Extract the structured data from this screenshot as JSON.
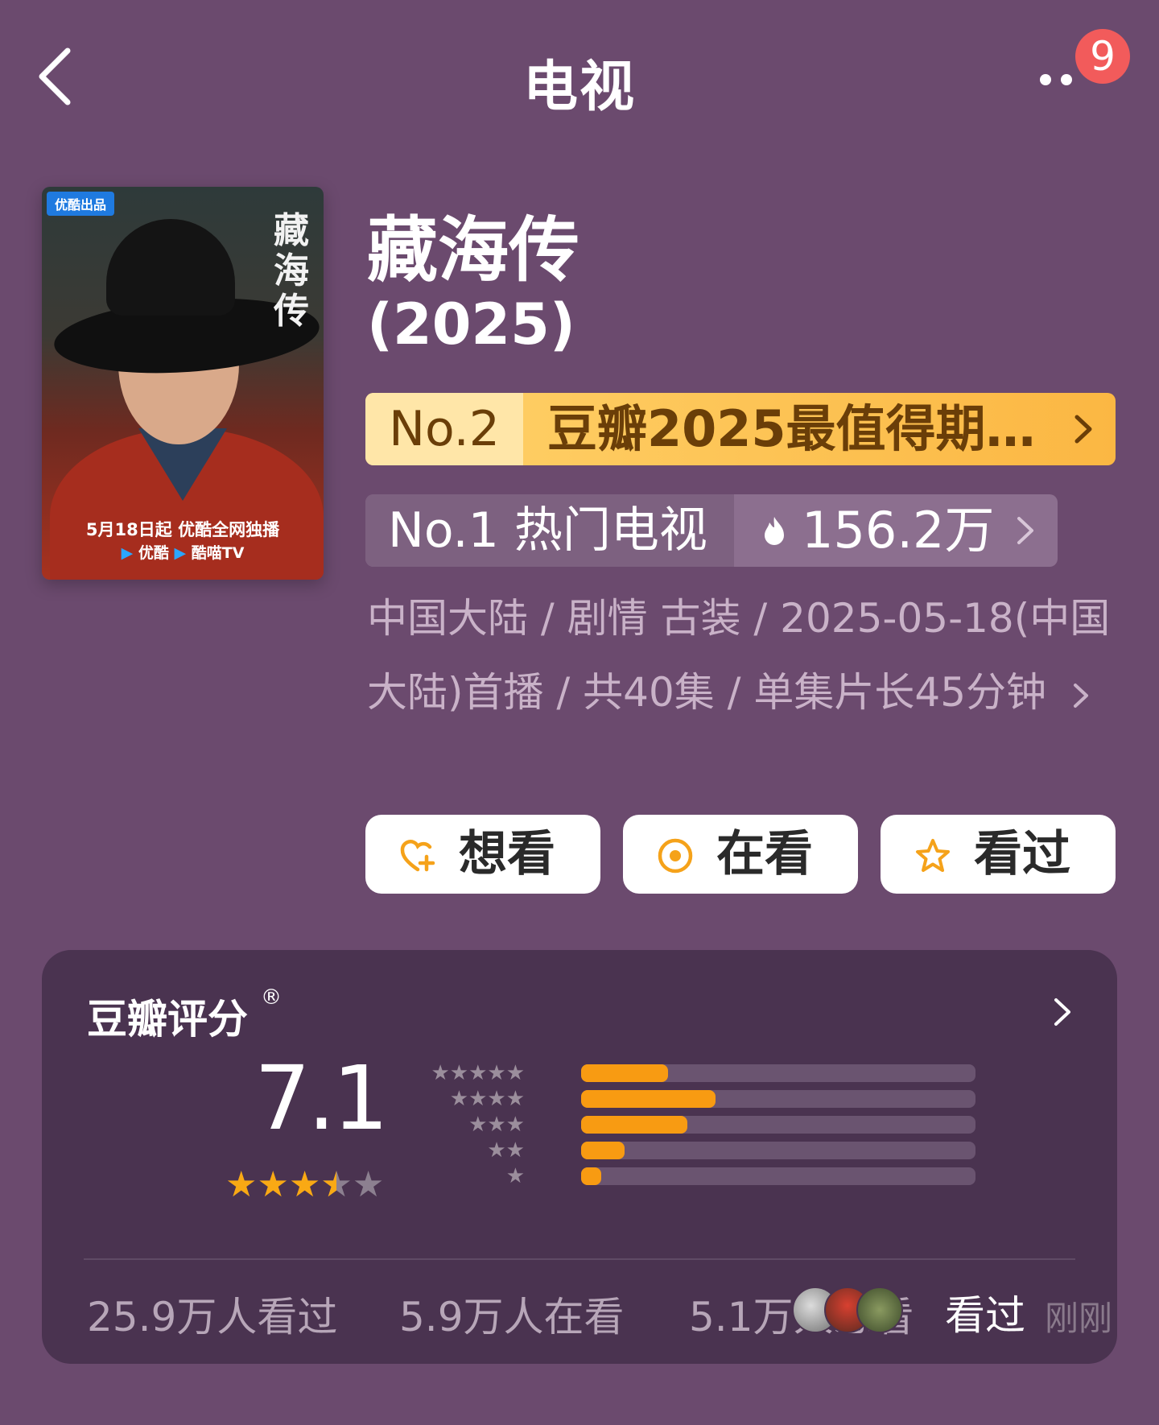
{
  "header": {
    "title": "电视",
    "notification_count": "9"
  },
  "poster": {
    "tag": "优酷出品",
    "calligraphy": "藏海传",
    "air_text": "5月18日起 优酷全网独播",
    "platform_1": "优酷",
    "platform_2": "酷喵TV"
  },
  "show": {
    "title": "藏海传",
    "year": "(2025)"
  },
  "rank_badges": [
    {
      "rank": "No.2",
      "text": "豆瓣2025最值得期…"
    },
    {
      "rank": "No.1 热门电视",
      "heat": "156.2万"
    }
  ],
  "meta_text": "中国大陆 / 剧情 古装 / 2025-05-18(中国大陆)首播 / 共40集 / 单集片长45分钟",
  "actions": [
    {
      "label": "想看",
      "icon": "heart-plus-icon"
    },
    {
      "label": "在看",
      "icon": "target-circle-icon"
    },
    {
      "label": "看过",
      "icon": "star-outline-icon"
    }
  ],
  "rating": {
    "title": "豆瓣评分",
    "registered_mark": "®",
    "score": "7.1",
    "stars_out_of_5": 3.5,
    "distribution": [
      {
        "stars": 5,
        "fraction": 0.22
      },
      {
        "stars": 4,
        "fraction": 0.34
      },
      {
        "stars": 3,
        "fraction": 0.27
      },
      {
        "stars": 2,
        "fraction": 0.11
      },
      {
        "stars": 1,
        "fraction": 0.05
      }
    ],
    "stats": [
      "25.9万人看过",
      "5.9万人在看",
      "5.1万人想看"
    ],
    "recent_activity": {
      "text": "看过",
      "time": "刚刚"
    }
  },
  "colors": {
    "background": "#6b4a6e",
    "card": "#4a3350",
    "accent_orange": "#f89b12",
    "gold_badge": "#fbb743",
    "badge_red": "#f25b5b"
  }
}
